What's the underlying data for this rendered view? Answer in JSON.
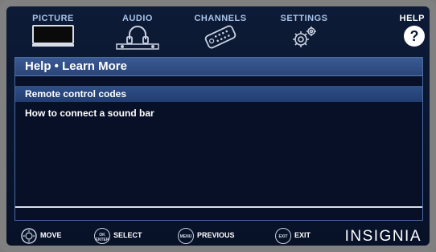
{
  "tabs": [
    {
      "label": "PICTURE",
      "icon": "tv-icon",
      "active": false
    },
    {
      "label": "AUDIO",
      "icon": "headphones-icon",
      "active": false
    },
    {
      "label": "CHANNELS",
      "icon": "remote-icon",
      "active": false
    },
    {
      "label": "SETTINGS",
      "icon": "gears-icon",
      "active": false
    },
    {
      "label": "HELP",
      "icon": "question-icon",
      "active": true
    }
  ],
  "panel": {
    "title": "Help • Learn More",
    "items": [
      {
        "label": "Remote control codes",
        "selected": true
      },
      {
        "label": "How to connect a sound bar",
        "selected": false
      }
    ]
  },
  "footer": {
    "hints": [
      {
        "button_text": "",
        "label": "MOVE",
        "icon": "dpad-icon"
      },
      {
        "button_text": "OK ENTER",
        "label": "SELECT",
        "icon": "ok-enter-icon"
      },
      {
        "button_text": "MENU",
        "label": "PREVIOUS",
        "icon": "menu-icon"
      },
      {
        "button_text": "EXIT",
        "label": "EXIT",
        "icon": "exit-icon"
      }
    ],
    "brand": "INSIGNIA"
  },
  "colors": {
    "background": "#0b1730",
    "panel_header": "#345089",
    "selected_row": "#2a4780",
    "tab_label": "#a9c3e8",
    "text": "#ffffff"
  }
}
